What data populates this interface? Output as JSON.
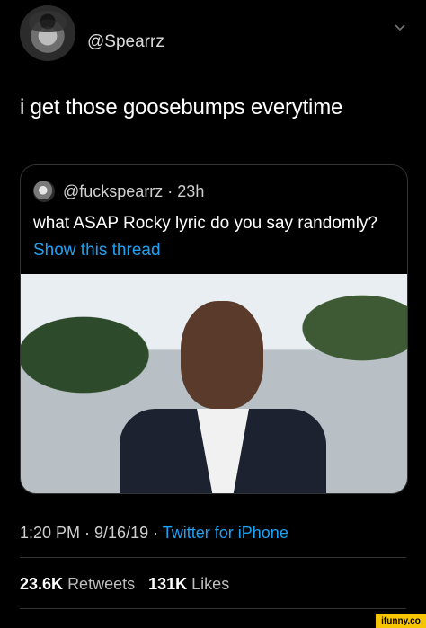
{
  "tweet": {
    "handle": "@Spearrz",
    "text": "i get those goosebumps everytime",
    "timestamp_line": "1:20 PM · 9/16/19 · ",
    "source": "Twitter for iPhone",
    "retweets_count": "23.6K",
    "retweets_label": "Retweets",
    "likes_count": "131K",
    "likes_label": "Likes"
  },
  "quote": {
    "meta": "@fuckspearrz · 23h",
    "text": "what ASAP Rocky lyric do you say randomly?",
    "link": "Show this thread"
  },
  "watermark": "ifunny.co",
  "colors": {
    "accent": "#1da1f2",
    "bg": "#000000"
  }
}
